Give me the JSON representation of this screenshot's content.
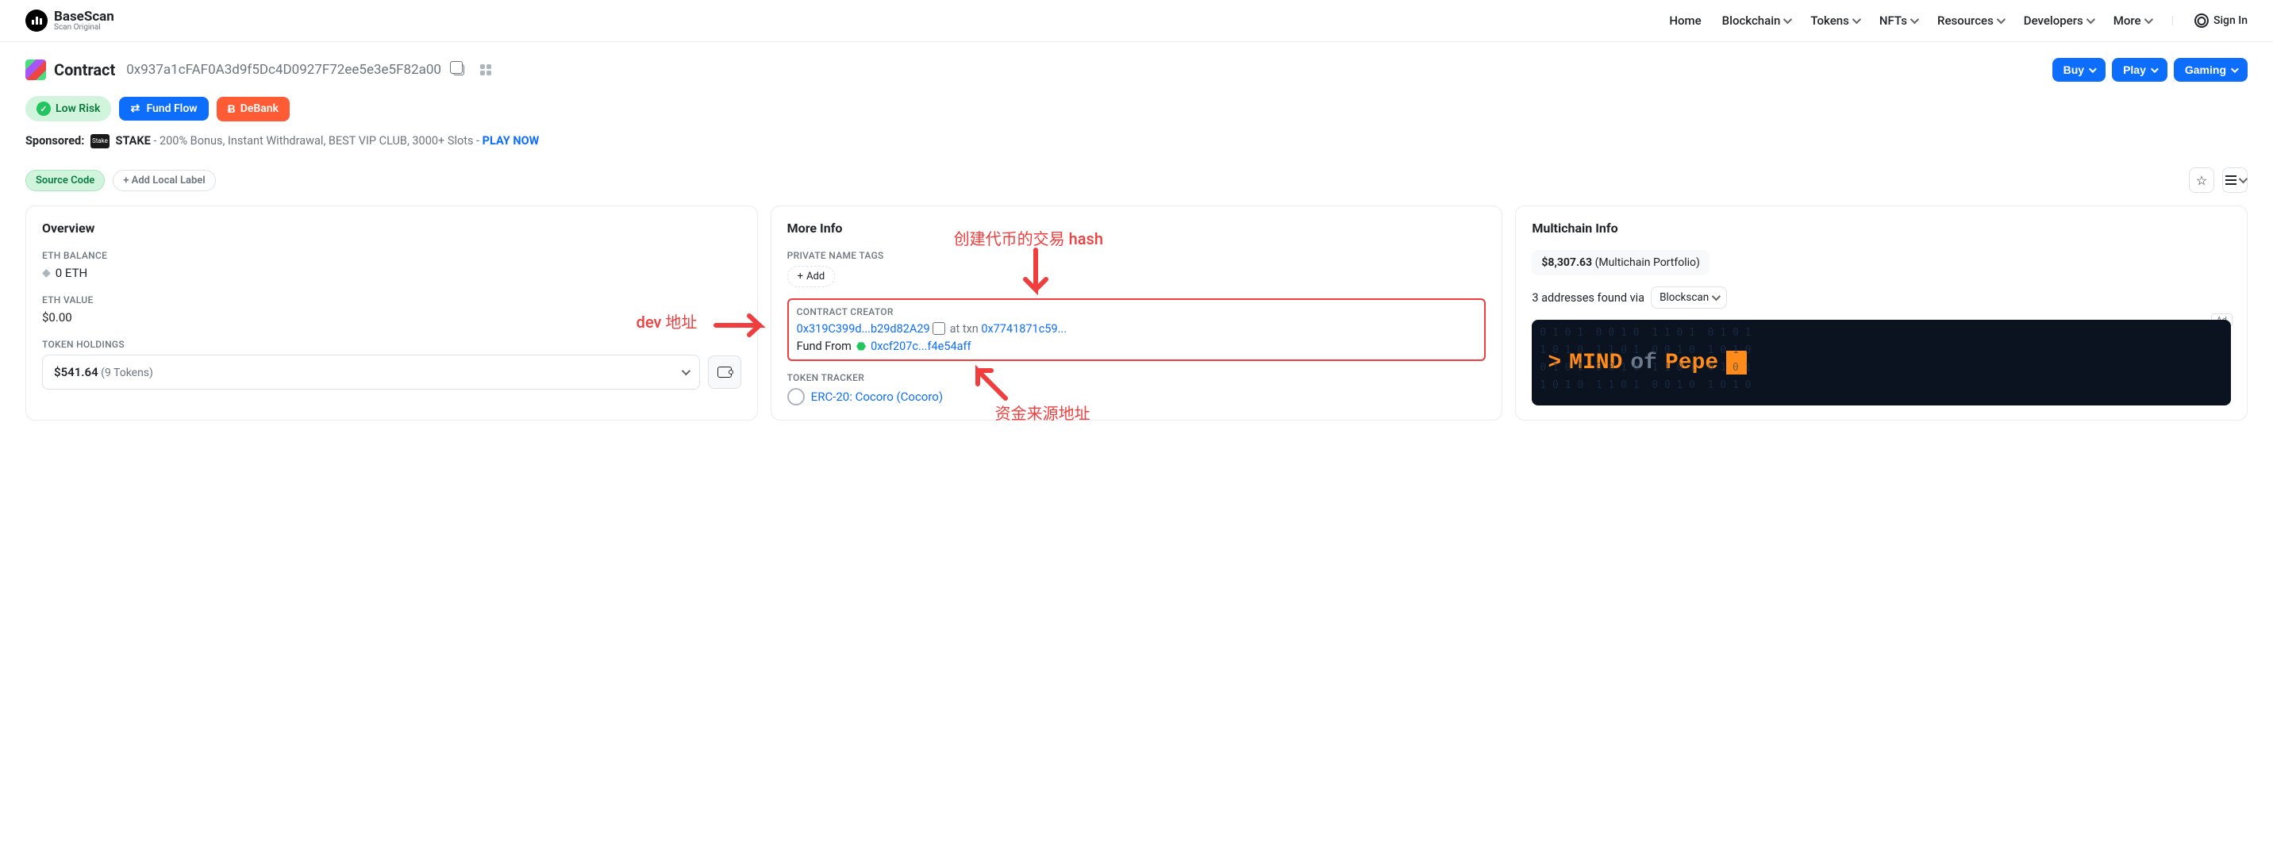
{
  "header": {
    "logo_name": "BaseScan",
    "logo_tag": "Scan Original",
    "nav": [
      "Home",
      "Blockchain",
      "Tokens",
      "NFTs",
      "Resources",
      "Developers",
      "More"
    ],
    "signin": "Sign In"
  },
  "title": {
    "label": "Contract",
    "address": "0x937a1cFAF0A3d9f5Dc4D0927F72ee5e3e5F82a00",
    "buttons": {
      "buy": "Buy",
      "play": "Play",
      "gaming": "Gaming"
    }
  },
  "badges": {
    "lowrisk": "Low Risk",
    "fundflow": "Fund Flow",
    "debank": "DeBank"
  },
  "sponsored": {
    "prefix": "Sponsored:",
    "brand": "STAKE",
    "text": " - 200% Bonus, Instant Withdrawal, BEST VIP CLUB, 3000+ Slots - ",
    "cta": "PLAY NOW"
  },
  "tags": {
    "source": "Source Code",
    "addlabel": "+ Add Local Label"
  },
  "overview": {
    "title": "Overview",
    "balance_label": "ETH BALANCE",
    "balance": "0 ETH",
    "value_label": "ETH VALUE",
    "value": "$0.00",
    "holdings_label": "TOKEN HOLDINGS",
    "holdings_amount": "$541.64",
    "holdings_count": "(9 Tokens)"
  },
  "moreinfo": {
    "title": "More Info",
    "tags_label": "PRIVATE NAME TAGS",
    "add": "Add",
    "creator_label": "CONTRACT CREATOR",
    "creator_addr": "0x319C399d...b29d82A29",
    "at_txn": "at txn",
    "txn": "0x7741871c59...",
    "fund_from_label": "Fund From",
    "fund_from_addr": "0xcf207c...f4e54aff",
    "tracker_label": "TOKEN TRACKER",
    "tracker": "ERC-20: Cocoro (Cocoro)"
  },
  "annotations": {
    "dev": "dev 地址",
    "hash": "创建代币的交易 hash",
    "source": "资金来源地址"
  },
  "multichain": {
    "title": "Multichain Info",
    "portfolio_amount": "$8,307.63",
    "portfolio_label": "(Multichain Portfolio)",
    "found": "3 addresses found via",
    "blockscan": "Blockscan",
    "ad": {
      "label": "Ad",
      "prompt": ">",
      "mind": "MIND",
      "of": "of",
      "pepe": "Pepe"
    }
  }
}
